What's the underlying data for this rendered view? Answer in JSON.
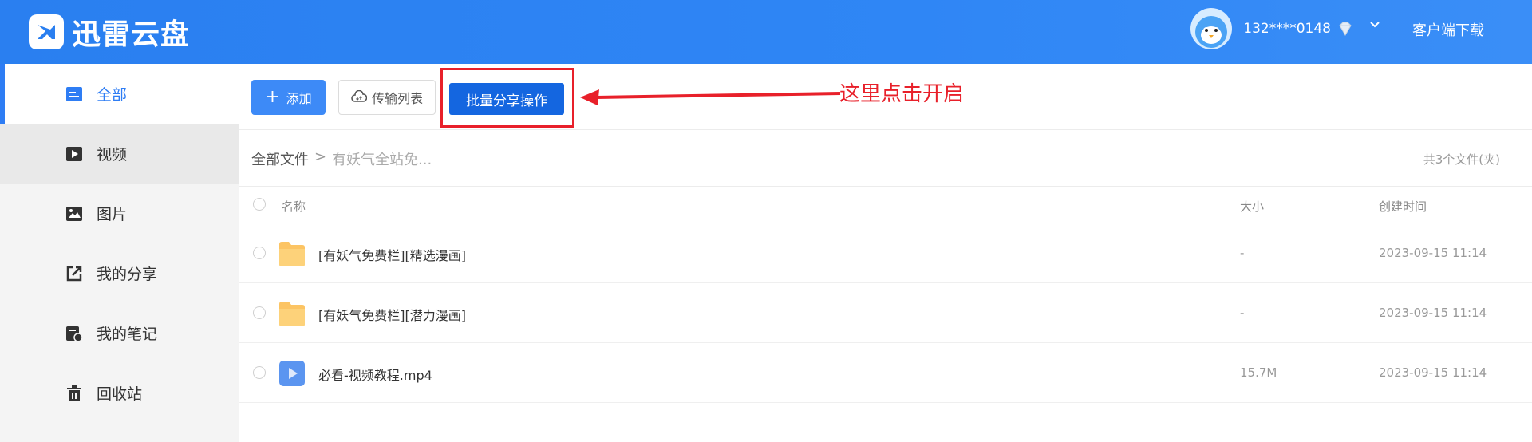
{
  "header": {
    "app_name": "迅雷云盘",
    "phone": "132****0148",
    "download_label": "客户端下载",
    "bg_color": "#2f86f5"
  },
  "sidebar": {
    "items": [
      {
        "label": "全部",
        "icon": "list-icon",
        "active": true
      },
      {
        "label": "视频",
        "icon": "video-icon"
      },
      {
        "label": "图片",
        "icon": "image-icon"
      },
      {
        "label": "我的分享",
        "icon": "share-icon"
      },
      {
        "label": "我的笔记",
        "icon": "note-icon"
      },
      {
        "label": "回收站",
        "icon": "trash-icon"
      }
    ]
  },
  "toolbar": {
    "add_label": "添加",
    "transfer_label": "传输列表",
    "batch_share_label": "批量分享操作"
  },
  "annotation": {
    "text": "这里点击开启",
    "color": "#e8202a"
  },
  "breadcrumb": {
    "root": "全部文件",
    "separator": ">",
    "current": "有妖气全站免..."
  },
  "file_count": "共3个文件(夹)",
  "table": {
    "headers": {
      "name": "名称",
      "size": "大小",
      "created": "创建时间"
    },
    "rows": [
      {
        "name": "[有妖气免费栏][精选漫画]",
        "size": "-",
        "created": "2023-09-15 11:14",
        "type": "folder"
      },
      {
        "name": "[有妖气免费栏][潜力漫画]",
        "size": "-",
        "created": "2023-09-15 11:14",
        "type": "folder"
      },
      {
        "name": "必看-视频教程.mp4",
        "size": "15.7M",
        "created": "2023-09-15 11:14",
        "type": "video"
      }
    ]
  }
}
